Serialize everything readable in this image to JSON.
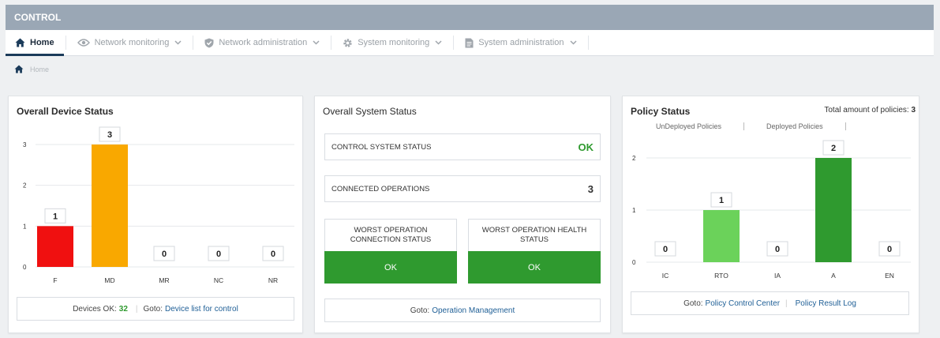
{
  "app": {
    "title": "CONTROL"
  },
  "nav": {
    "home": "Home",
    "network_monitoring": "Network monitoring",
    "network_administration": "Network administration",
    "system_monitoring": "System monitoring",
    "system_administration": "System administration"
  },
  "breadcrumb": {
    "home": "Home"
  },
  "device_status": {
    "title": "Overall Device Status",
    "footer": {
      "devices_ok_label": "Devices OK:",
      "devices_ok_count": "32",
      "goto_label": "Goto:",
      "link": "Device list for control"
    }
  },
  "system_status": {
    "title": "Overall System Status",
    "control_system_status": {
      "label": "CONTROL SYSTEM STATUS",
      "value": "OK"
    },
    "connected_operations": {
      "label": "CONNECTED OPERATIONS",
      "value": "3"
    },
    "worst_connection": {
      "label": "WORST OPERATION CONNECTION STATUS",
      "value": "OK"
    },
    "worst_health": {
      "label": "WORST OPERATION HEALTH STATUS",
      "value": "OK"
    },
    "footer": {
      "goto_label": "Goto:",
      "link": "Operation Management"
    }
  },
  "policy_status": {
    "title": "Policy Status",
    "total_label": "Total amount of policies:",
    "total_value": "3",
    "legend": [
      "UnDeployed Policies",
      "Deployed Policies"
    ],
    "footer": {
      "goto_label": "Goto:",
      "link1": "Policy Control Center",
      "link2": "Policy Result Log"
    }
  },
  "colors": {
    "red": "#f01010",
    "orange": "#f9a800",
    "light_green": "#6bd25a",
    "dark_green": "#2f9a2f",
    "header": "#9aa7b5"
  },
  "chart_data": [
    {
      "type": "bar",
      "categories": [
        "F",
        "MD",
        "MR",
        "NC",
        "NR"
      ],
      "values": [
        1,
        3,
        0,
        0,
        0
      ],
      "bar_colors": [
        "#f01010",
        "#f9a800",
        null,
        null,
        null
      ],
      "yticks": [
        0,
        1,
        2,
        3
      ],
      "ylim": [
        0,
        3
      ],
      "grid": true,
      "title": "Overall Device Status"
    },
    {
      "type": "bar",
      "categories": [
        "IC",
        "RTO",
        "IA",
        "A",
        "EN"
      ],
      "values": [
        0,
        1,
        0,
        2,
        0
      ],
      "bar_colors": [
        null,
        "#6bd25a",
        null,
        "#2f9a2f",
        null
      ],
      "yticks": [
        0,
        1,
        2
      ],
      "ylim": [
        0,
        2
      ],
      "grid": true,
      "title": "Policy Status"
    }
  ]
}
